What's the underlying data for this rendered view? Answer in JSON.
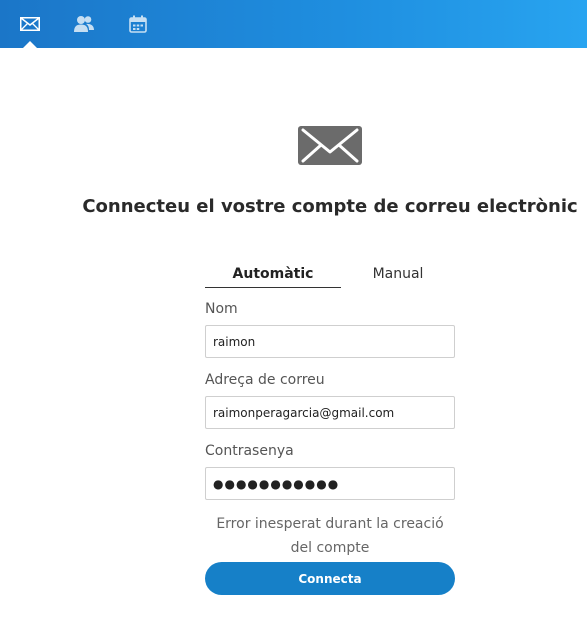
{
  "topbar": {
    "tabs": [
      {
        "icon": "mail-icon",
        "active": true
      },
      {
        "icon": "contacts-icon",
        "active": false
      },
      {
        "icon": "calendar-icon",
        "active": false
      }
    ],
    "color": "#1f8fe0"
  },
  "setup": {
    "heading": "Connecteu el vostre compte de correu electrònic",
    "modes": {
      "automatic": "Automàtic",
      "manual": "Manual"
    },
    "name_label": "Nom",
    "name_value": "raimon",
    "email_label": "Adreça de correu",
    "email_value": "raimonperagarcia@gmail.com",
    "password_label": "Contrasenya",
    "password_value": "●●●●●●●●●●●",
    "error_message": "Error inesperat durant la creació del compte",
    "connect_label": "Connecta",
    "accent_color": "#1680c8"
  }
}
